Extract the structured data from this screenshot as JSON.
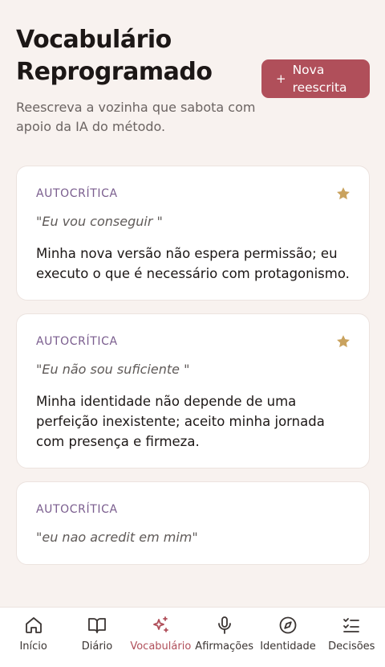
{
  "header": {
    "title": "Vocabulário Reprogramado",
    "subtitle": "Reescreva a vozinha que sabota com apoio da IA do método.",
    "new_button": {
      "plus": "+",
      "label": "Nova reescrita"
    }
  },
  "cards": [
    {
      "tag": "AUTOCRÍTICA",
      "starred": true,
      "quote": "\"Eu vou conseguir \"",
      "body": "Minha nova versão não espera permissão; eu executo o que é necessário com protagonismo."
    },
    {
      "tag": "AUTOCRÍTICA",
      "starred": true,
      "quote": "\"Eu não sou suficiente \"",
      "body": "Minha identidade não depende de uma perfeição inexistente; aceito minha jornada com presença e firmeza."
    },
    {
      "tag": "AUTOCRÍTICA",
      "starred": false,
      "quote": "\"eu nao acredit em mim\"",
      "body": ""
    }
  ],
  "nav": {
    "items": [
      {
        "label": "Início",
        "icon": "home-icon"
      },
      {
        "label": "Diário",
        "icon": "book-icon"
      },
      {
        "label": "Vocabulário",
        "icon": "sparkles-icon",
        "active": true
      },
      {
        "label": "Afirmações",
        "icon": "microphone-icon"
      },
      {
        "label": "Identidade",
        "icon": "compass-icon"
      },
      {
        "label": "Decisões",
        "icon": "checklist-icon"
      }
    ]
  },
  "colors": {
    "accent": "#b04f5a",
    "tag": "#7a5d8e",
    "star": "#c9a25e",
    "background": "#f8f2ef"
  }
}
